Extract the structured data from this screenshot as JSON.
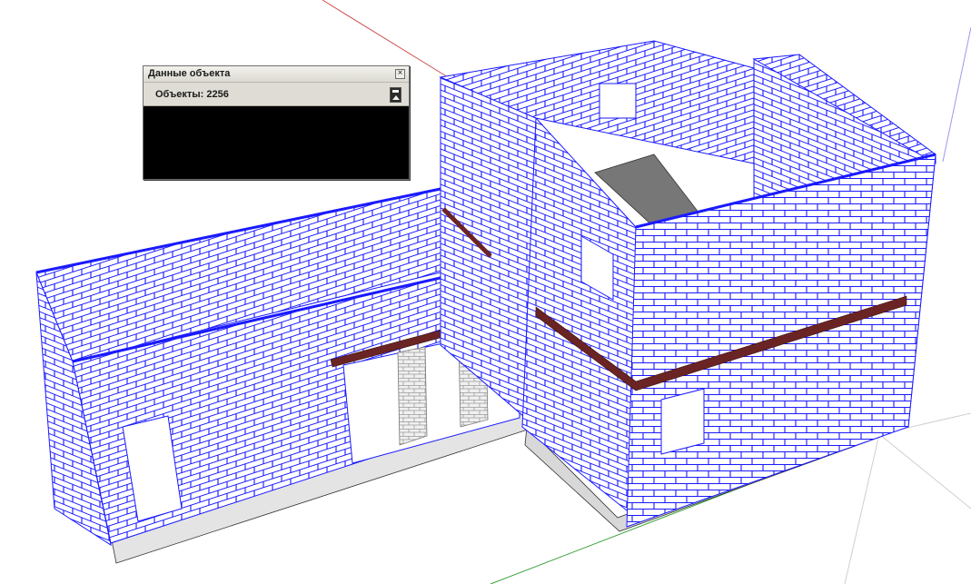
{
  "panel": {
    "title": "Данные объекта",
    "close_glyph": "×",
    "objects_label": "Объекты: 2256"
  },
  "icons": {
    "close": "close-icon",
    "collapse": "collapse-panel-icon"
  },
  "colors": {
    "brick_outline": "#0000ff",
    "brick_fill": "#ffffff",
    "lintel": "#6b2424",
    "red_axis": "#d05050",
    "green_axis": "#3ca33c",
    "blue_axis": "#9a9af0",
    "panel_background": "#000000"
  }
}
